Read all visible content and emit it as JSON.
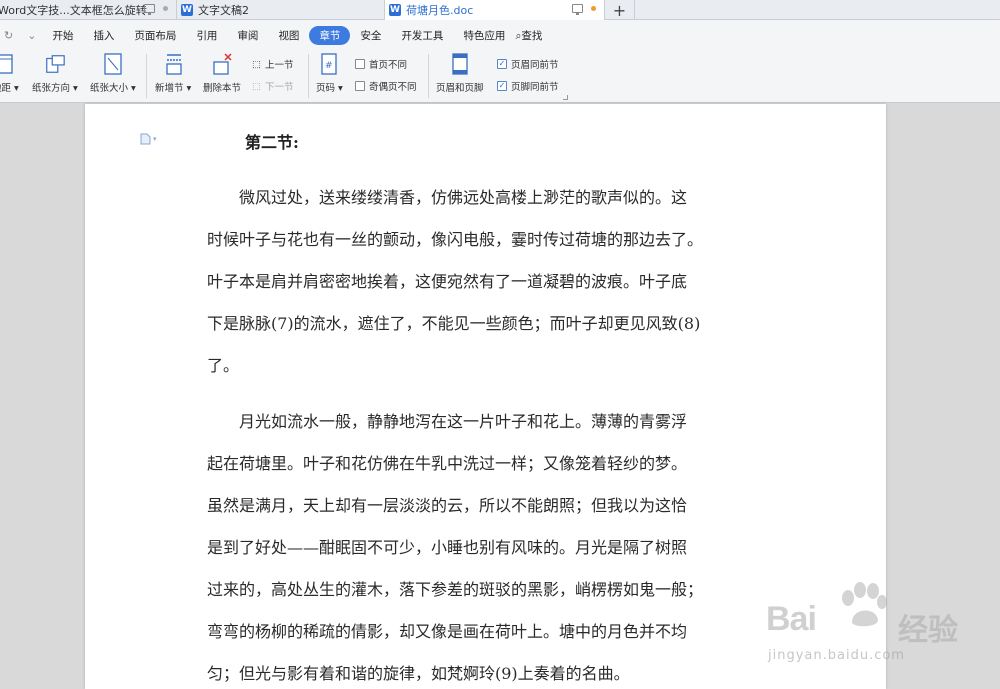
{
  "tabs": [
    {
      "label": "Word文字技...文本框怎么旋转",
      "icon": "",
      "active": false
    },
    {
      "label": "文字文稿2",
      "icon": "W",
      "active": false
    },
    {
      "label": "荷塘月色.doc",
      "icon": "W",
      "active": true
    }
  ],
  "new_tab_label": "+",
  "menu": {
    "items": [
      "开始",
      "插入",
      "页面布局",
      "引用",
      "审阅",
      "视图",
      "章节",
      "安全",
      "开发工具",
      "特色应用"
    ],
    "active": "章节",
    "search_label": "查找"
  },
  "toolbar": {
    "margins_label": "边距",
    "orientation_label": "纸张方向",
    "size_label": "纸张大小",
    "new_section_label": "新增节",
    "delete_section_label": "删除本节",
    "prev_section_label": "上一节",
    "next_section_label": "下一节",
    "page_number_label": "页码",
    "first_page_diff_label": "首页不同",
    "odd_even_diff_label": "奇偶页不同",
    "header_footer_label": "页眉和页脚",
    "header_same_prev_label": "页眉同前节",
    "footer_same_prev_label": "页脚同前节",
    "first_page_diff_checked": false,
    "odd_even_diff_checked": false,
    "header_same_prev_checked": true,
    "footer_same_prev_checked": true
  },
  "document": {
    "heading": "第二节:",
    "paragraph1_lines": [
      "　　微风过处，送来缕缕清香，仿佛远处高楼上渺茫的歌声似的。这",
      "时候叶子与花也有一丝的颤动，像闪电般，霎时传过荷塘的那边去了。",
      "叶子本是肩并肩密密地挨着，这便宛然有了一道凝碧的波痕。叶子底",
      "下是脉脉(7)的流水，遮住了，不能见一些颜色；而叶子却更见风致(8)",
      "了。"
    ],
    "paragraph2_lines": [
      "　　月光如流水一般，静静地泻在这一片叶子和花上。薄薄的青雾浮",
      "起在荷塘里。叶子和花仿佛在牛乳中洗过一样；又像笼着轻纱的梦。",
      "虽然是满月，天上却有一层淡淡的云，所以不能朗照；但我以为这恰",
      "是到了好处——酣眠固不可少，小睡也别有风味的。月光是隔了树照",
      "过来的，高处丛生的灌木，落下参差的斑驳的黑影，峭楞楞如鬼一般；",
      "弯弯的杨柳的稀疏的倩影，却又像是画在荷叶上。塘中的月色并不均",
      "匀；但光与影有着和谐的旋律，如梵婀玲(9)上奏着的名曲。"
    ]
  },
  "watermark": {
    "brand": "Bai",
    "brand2": "经验",
    "url": "jingyan.baidu.com"
  },
  "colors": {
    "accent": "#3d7be0",
    "active_tab_text": "#2c6fd1"
  }
}
